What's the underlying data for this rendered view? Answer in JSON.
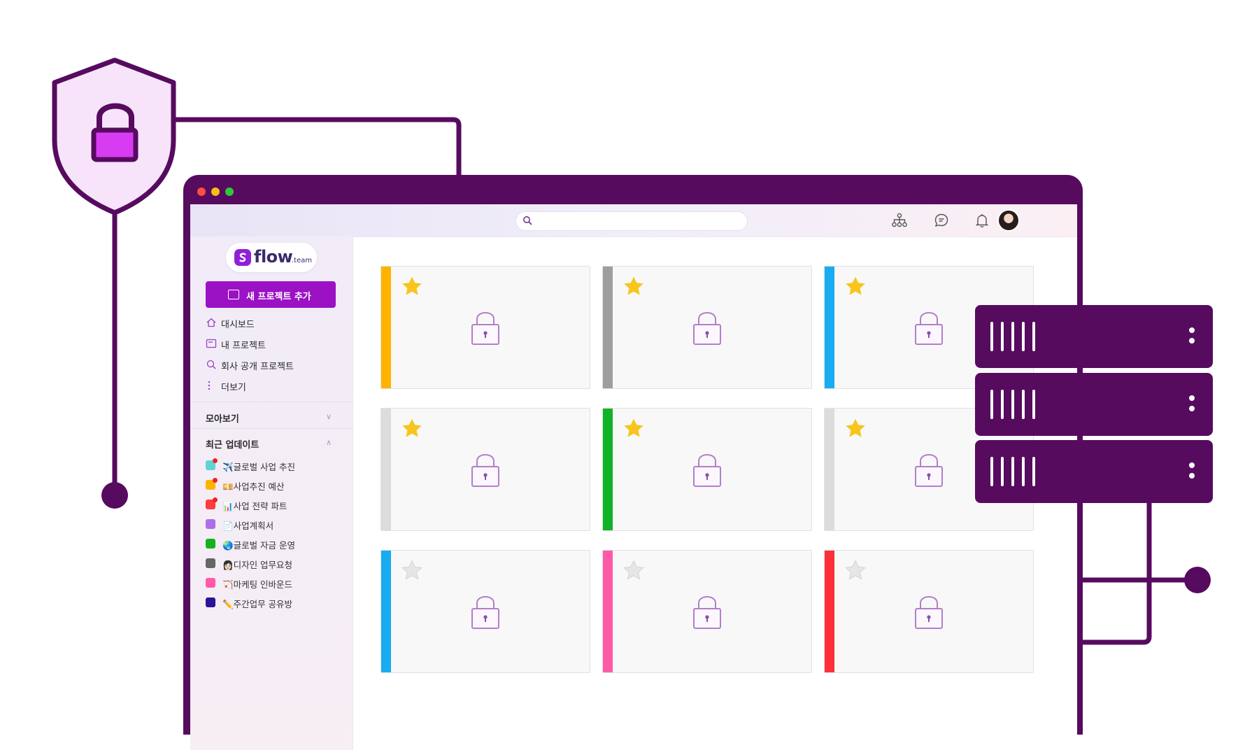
{
  "window": {
    "traffic_lights": [
      {
        "name": "close",
        "color": "#ff4e3b"
      },
      {
        "name": "minimize",
        "color": "#f6bd16"
      },
      {
        "name": "maximize",
        "color": "#2fc83b"
      }
    ]
  },
  "topbar": {
    "search_placeholder": "",
    "icons": [
      "org-chart-icon",
      "chat-icon",
      "bell-icon"
    ]
  },
  "sidebar": {
    "logo_text": "flow",
    "logo_suffix": ".team",
    "new_project_label": "새 프로젝트 추가",
    "nav": [
      {
        "icon": "home-icon",
        "label": "대시보드"
      },
      {
        "icon": "project-icon",
        "label": "내 프로젝트"
      },
      {
        "icon": "search-icon",
        "label": "회사 공개 프로젝트"
      },
      {
        "icon": "more-icon",
        "label": "더보기"
      }
    ],
    "collection_label": "모아보기",
    "recent_label": "최근 업데이트",
    "recent_projects": [
      {
        "label": "✈️글로벌 사업 추진",
        "color": "#5fd4d4",
        "badge": true
      },
      {
        "label": "💴사업추진 예산",
        "color": "#ffb300",
        "badge": true
      },
      {
        "label": "📊사업 전략 파트",
        "color": "#ff3b3b",
        "badge": true
      },
      {
        "label": "📄사업계획서",
        "color": "#b06ee6",
        "badge": false
      },
      {
        "label": "🌏글로벌 자금 운영",
        "color": "#14b21e",
        "badge": false
      },
      {
        "label": "👩🏻디자인 업무요청",
        "color": "#666666",
        "badge": false
      },
      {
        "label": "🏹마케팅 인바운드",
        "color": "#ff5aa8",
        "badge": false
      },
      {
        "label": "✏️주간업무 공유방",
        "color": "#2a1596",
        "badge": false
      }
    ]
  },
  "cards": [
    {
      "color": "#ffb300",
      "starred": true
    },
    {
      "color": "#9e9e9e",
      "starred": true
    },
    {
      "color": "#18acf0",
      "starred": true
    },
    {
      "color": "#dcdcdc",
      "starred": true
    },
    {
      "color": "#10b226",
      "starred": true
    },
    {
      "color": "#dcdcdc",
      "starred": true
    },
    {
      "color": "#18acf0",
      "starred": false
    },
    {
      "color": "#ff5aa8",
      "starred": false
    },
    {
      "color": "#ff3038",
      "starred": false
    }
  ],
  "colors": {
    "brand_purple": "#560b5f",
    "button_purple": "#9a12c4",
    "shield_fill": "#f7e4fa",
    "shield_lock": "#d83cf2",
    "star_gold": "#f8c51c",
    "lock_stroke": "#b27fc9"
  }
}
